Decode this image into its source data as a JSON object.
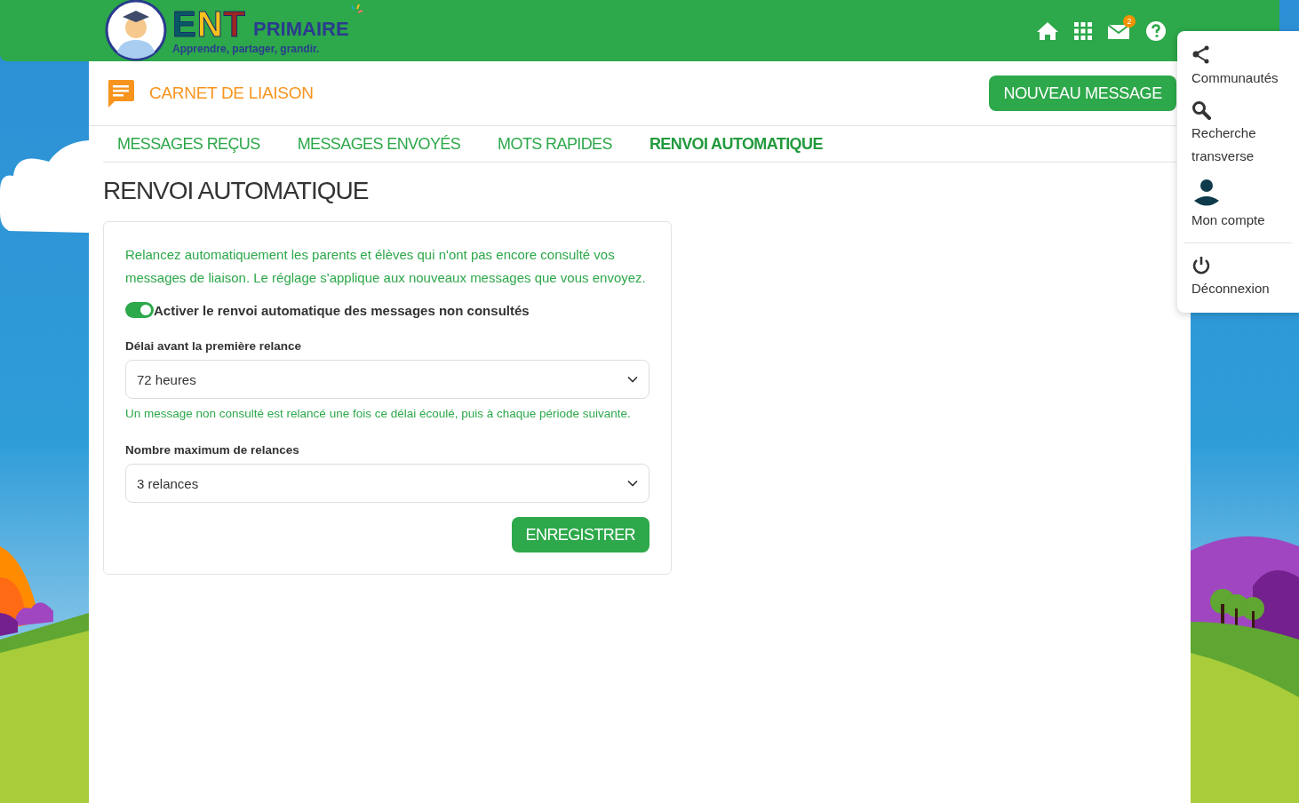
{
  "header": {
    "logo": {
      "brand": "ENT",
      "name": "PRIMAIRE",
      "tagline": "Apprendre, partager, grandir."
    },
    "mail_badge": "2"
  },
  "module": {
    "title": "CARNET DE LIAISON",
    "new_button": "NOUVEAU MESSAGE"
  },
  "tabs": [
    {
      "label": "MESSAGES REÇUS",
      "selected": false
    },
    {
      "label": "MESSAGES ENVOYÉS",
      "selected": false
    },
    {
      "label": "MOTS RAPIDES",
      "selected": false
    },
    {
      "label": "RENVOI AUTOMATIQUE",
      "selected": true
    }
  ],
  "page_title": "RENVOI AUTOMATIQUE",
  "form": {
    "intro": "Relancez automatiquement les parents et élèves qui n'ont pas encore consulté vos messages de liaison. Le réglage s'applique aux nouveaux messages que vous envoyez.",
    "toggle": {
      "label": "Activer le renvoi automatique des messages non consultés",
      "on": true
    },
    "fields": [
      {
        "label": "Délai avant la première relance",
        "value": "72 heures",
        "hint": "Un message non consulté est relancé une fois ce délai écoulé, puis à chaque période suivante."
      },
      {
        "label": "Nombre maximum de relances",
        "value": "3 relances"
      }
    ],
    "save_button": "ENREGISTRER"
  },
  "user_menu": {
    "items": [
      {
        "kind": "share",
        "label": "Communautés"
      },
      {
        "kind": "search",
        "label": "Recherche transverse"
      },
      {
        "kind": "account",
        "label": "Mon compte"
      },
      {
        "kind": "logout",
        "label": "Déconnexion"
      }
    ]
  }
}
